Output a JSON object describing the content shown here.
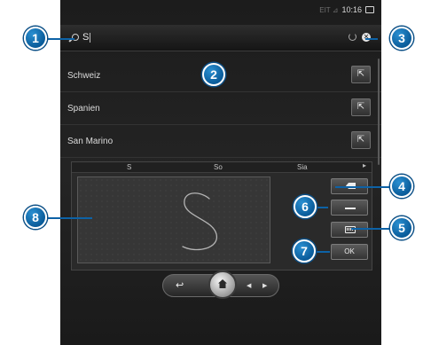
{
  "status_bar": {
    "dim_text": "EIT ⊿",
    "time": "10:16",
    "mail_icon": "envelope-icon"
  },
  "search": {
    "value": "S",
    "icon": "magnifier-icon",
    "refresh_icon": "refresh-icon",
    "clear_icon": "close-circle-icon"
  },
  "results": [
    {
      "label": "Schweiz",
      "action_glyph": "⇱"
    },
    {
      "label": "Spanien",
      "action_glyph": "⇱"
    },
    {
      "label": "San Marino",
      "action_glyph": "⇱"
    }
  ],
  "handwriting": {
    "suggestions": [
      "S",
      "So",
      "Sia"
    ],
    "more_glyph": "▸",
    "keys": {
      "backspace_icon": "backspace-icon",
      "space_icon": "space-icon",
      "keyboard_icon": "keyboard-icon",
      "ok_label": "OK"
    }
  },
  "nav": {
    "back_glyph": "↩",
    "home_icon": "home-icon",
    "prev_glyph": "◀",
    "next_glyph": "▶"
  },
  "callouts": [
    "1",
    "2",
    "3",
    "4",
    "5",
    "6",
    "7",
    "8"
  ],
  "colors": {
    "callout_blue": "#0a5c9a",
    "callout_outline": "#ffffff"
  }
}
